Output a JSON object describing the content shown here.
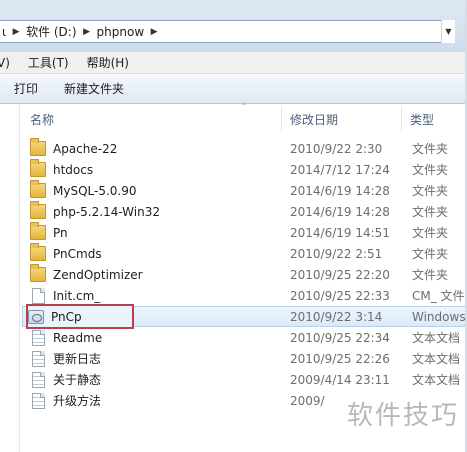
{
  "address": {
    "crumbs": [
      "软件 (D:)",
      "phpnow"
    ],
    "leading_fragment": "ι"
  },
  "menu": {
    "items": [
      "V)",
      "工具(T)",
      "帮助(H)"
    ]
  },
  "toolbar": {
    "print_label": "打印",
    "new_folder_label": "新建文件夹"
  },
  "columns": {
    "name": "名称",
    "date": "修改日期",
    "type": "类型"
  },
  "files": [
    {
      "name": "Apache-22",
      "date": "2010/9/22 2:30",
      "type": "文件夹",
      "icon": "folder-icon"
    },
    {
      "name": "htdocs",
      "date": "2014/7/12 17:24",
      "type": "文件夹",
      "icon": "folder-icon"
    },
    {
      "name": "MySQL-5.0.90",
      "date": "2014/6/19 14:28",
      "type": "文件夹",
      "icon": "folder-icon"
    },
    {
      "name": "php-5.2.14-Win32",
      "date": "2014/6/19 14:28",
      "type": "文件夹",
      "icon": "folder-icon"
    },
    {
      "name": "Pn",
      "date": "2014/6/19 14:51",
      "type": "文件夹",
      "icon": "folder-icon"
    },
    {
      "name": "PnCmds",
      "date": "2010/9/22 2:51",
      "type": "文件夹",
      "icon": "folder-icon"
    },
    {
      "name": "ZendOptimizer",
      "date": "2010/9/25 22:20",
      "type": "文件夹",
      "icon": "folder-icon"
    },
    {
      "name": "Init.cm_",
      "date": "2010/9/25 22:33",
      "type": "CM_ 文件",
      "icon": "file-icon"
    },
    {
      "name": "PnCp",
      "date": "2010/9/22 3:14",
      "type": "Windows",
      "icon": "application-icon"
    },
    {
      "name": "Readme",
      "date": "2010/9/25 22:34",
      "type": "文本文档",
      "icon": "text-file-icon"
    },
    {
      "name": "更新日志",
      "date": "2010/9/25 22:26",
      "type": "文本文档",
      "icon": "text-file-icon"
    },
    {
      "name": "关于静态",
      "date": "2009/4/14 23:11",
      "type": "文本文档",
      "icon": "text-file-icon"
    },
    {
      "name": "升级方法",
      "date": "2009/",
      "type": "",
      "icon": "text-file-icon"
    }
  ],
  "watermark": "软件技巧"
}
